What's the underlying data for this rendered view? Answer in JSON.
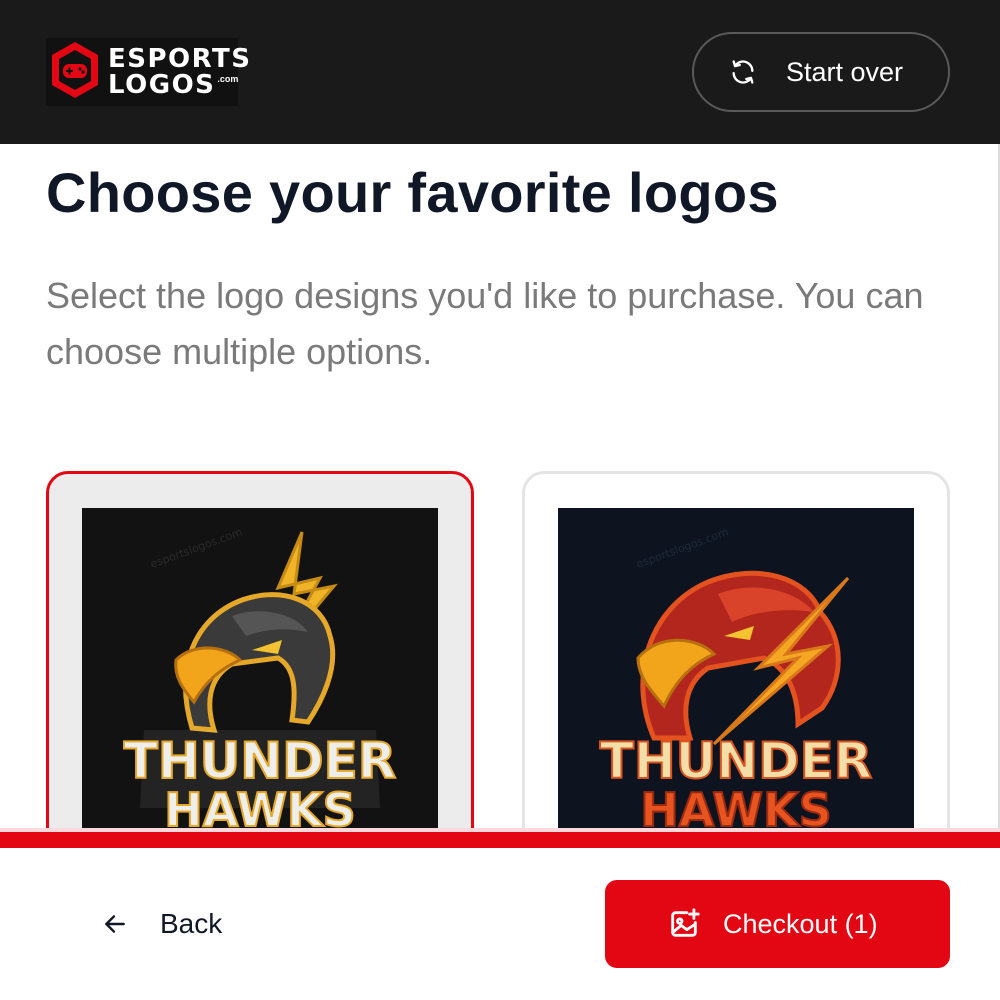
{
  "header": {
    "logo": {
      "line1": "ESPORTS",
      "line2": "LOGOS",
      "suffix": ".com",
      "icon": "gamepad-shield-icon"
    },
    "start_over": {
      "label": "Start over",
      "icon": "refresh-icon"
    }
  },
  "main": {
    "title": "Choose your favorite logos",
    "subtitle": "Select the logo designs you'd like to purchase. You can choose multiple options.",
    "logos": [
      {
        "selected": true,
        "line1": "THUNDER",
        "line2": "HAWKS",
        "watermark": "esportslogos.com"
      },
      {
        "selected": false,
        "line1": "THUNDER",
        "line2": "HAWKS",
        "watermark": "esportslogos.com"
      }
    ]
  },
  "footer": {
    "back": {
      "label": "Back",
      "icon": "arrow-left-icon"
    },
    "checkout": {
      "label": "Checkout (1)",
      "icon": "image-add-icon"
    }
  },
  "colors": {
    "accent": "#e30613",
    "header_bg": "#1a1a1a",
    "title": "#101828",
    "subtitle": "#7a7a7a"
  }
}
